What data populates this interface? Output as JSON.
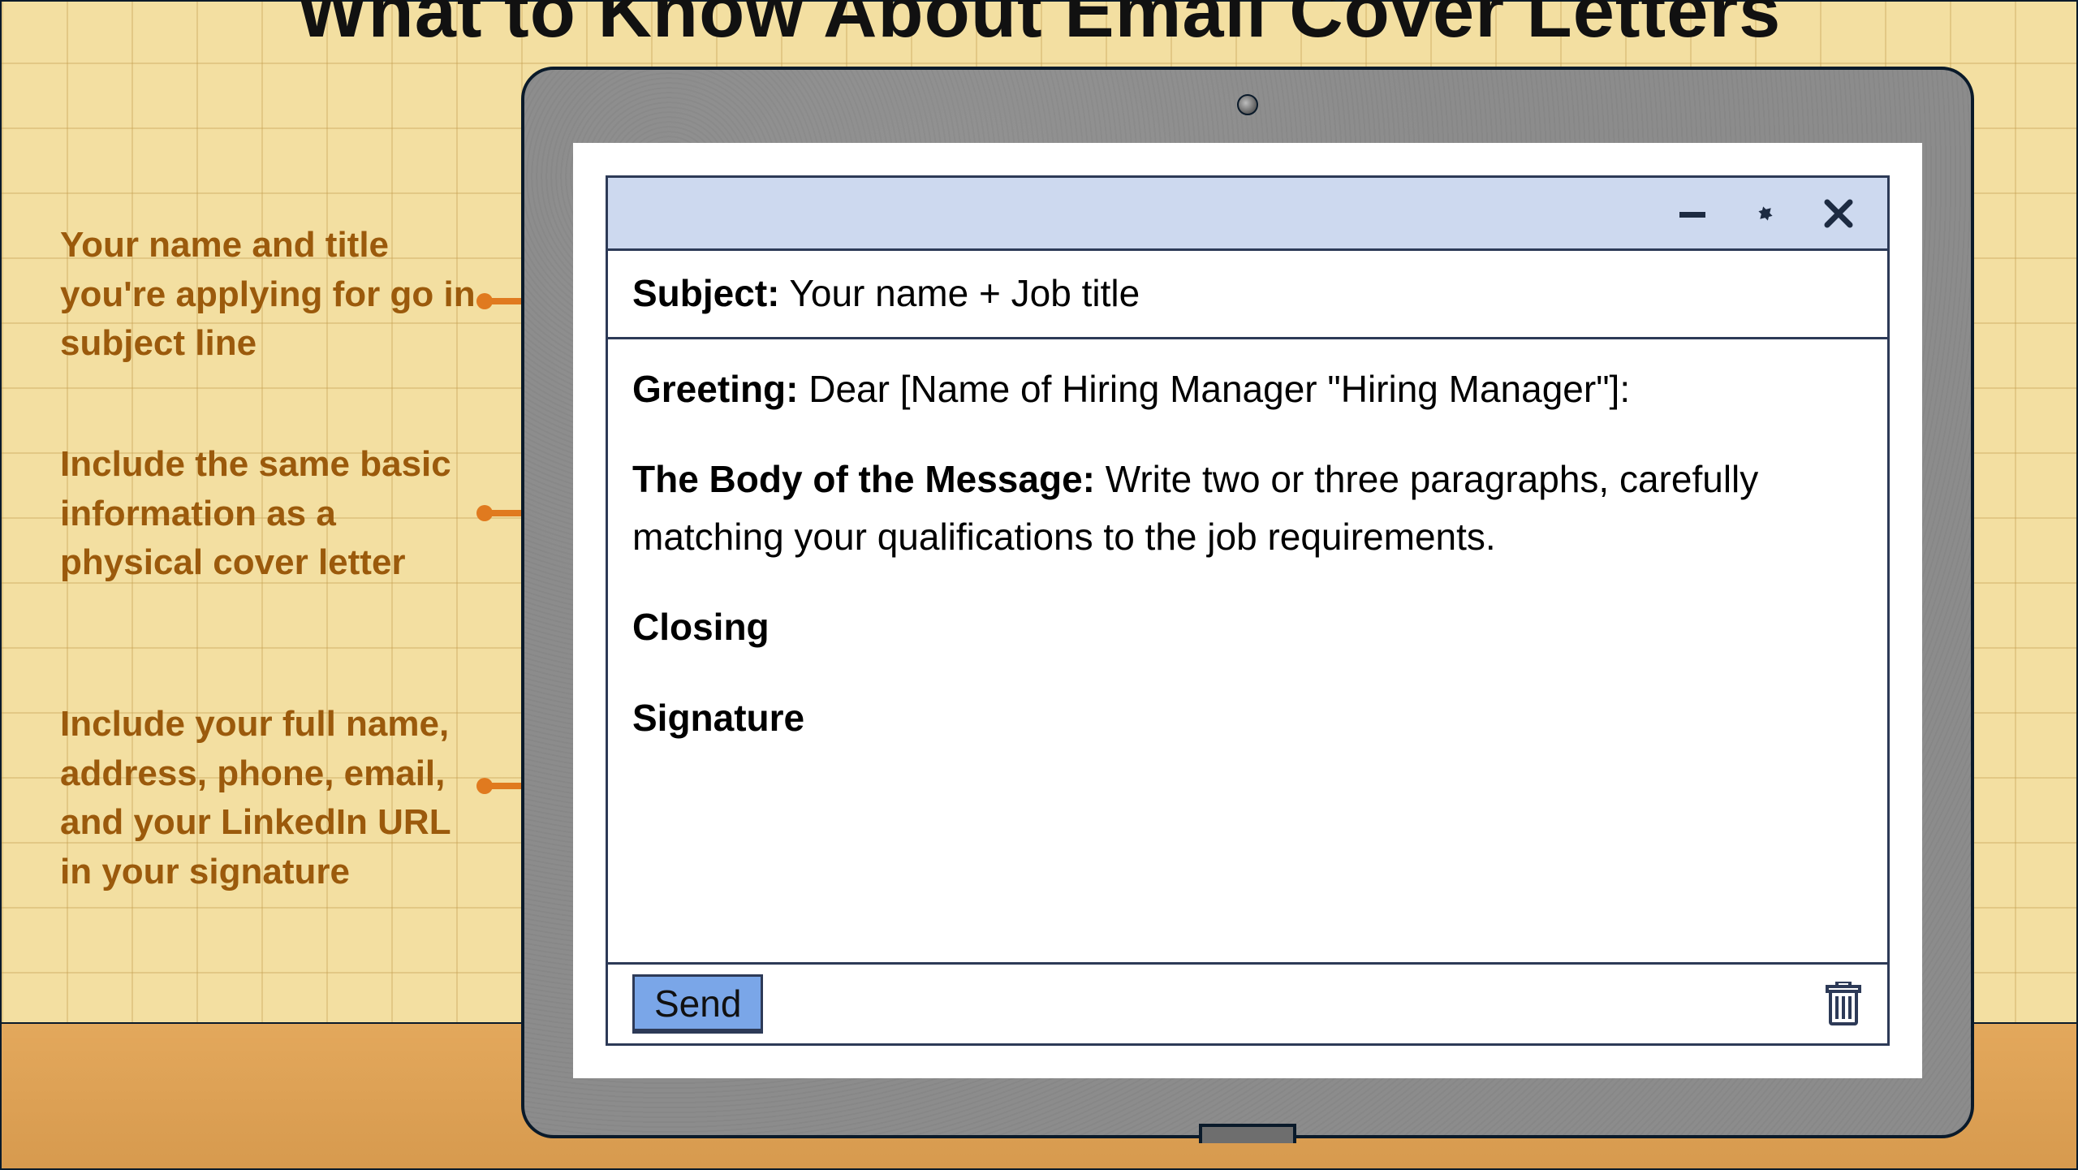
{
  "page_title": "What to Know About Email Cover Letters",
  "callouts": {
    "c1": "Your name and title you're applying for go in subject line",
    "c2": "Include the same basic information as a physical cover letter",
    "c3": "Include your full name, address, phone, email, and your LinkedIn URL in your signature"
  },
  "email": {
    "subject_label": "Subject:",
    "subject_value": "Your name + Job title",
    "greeting_label": "Greeting:",
    "greeting_value": "Dear [Name of Hiring Manager \"Hiring Manager\"]:",
    "body_label": "The Body of the Message:",
    "body_value": "Write two or three paragraphs, carefully matching your qualifications to the job requirements.",
    "closing_label": "Closing",
    "signature_label": "Signature",
    "send_label": "Send"
  },
  "icons": {
    "minimize": "minimize-icon",
    "maximize": "expand-icon",
    "close": "close-icon",
    "trash": "trash-icon",
    "camera": "camera-icon"
  },
  "colors": {
    "accent_text": "#9b5a0c",
    "pointer": "#e07a1f",
    "window_border": "#2d3a57",
    "titlebar_bg": "#cdd9ef",
    "send_bg": "#7aa6e8",
    "paper_bg": "#f3dfa1",
    "desk_bg": "#e3a85c"
  }
}
